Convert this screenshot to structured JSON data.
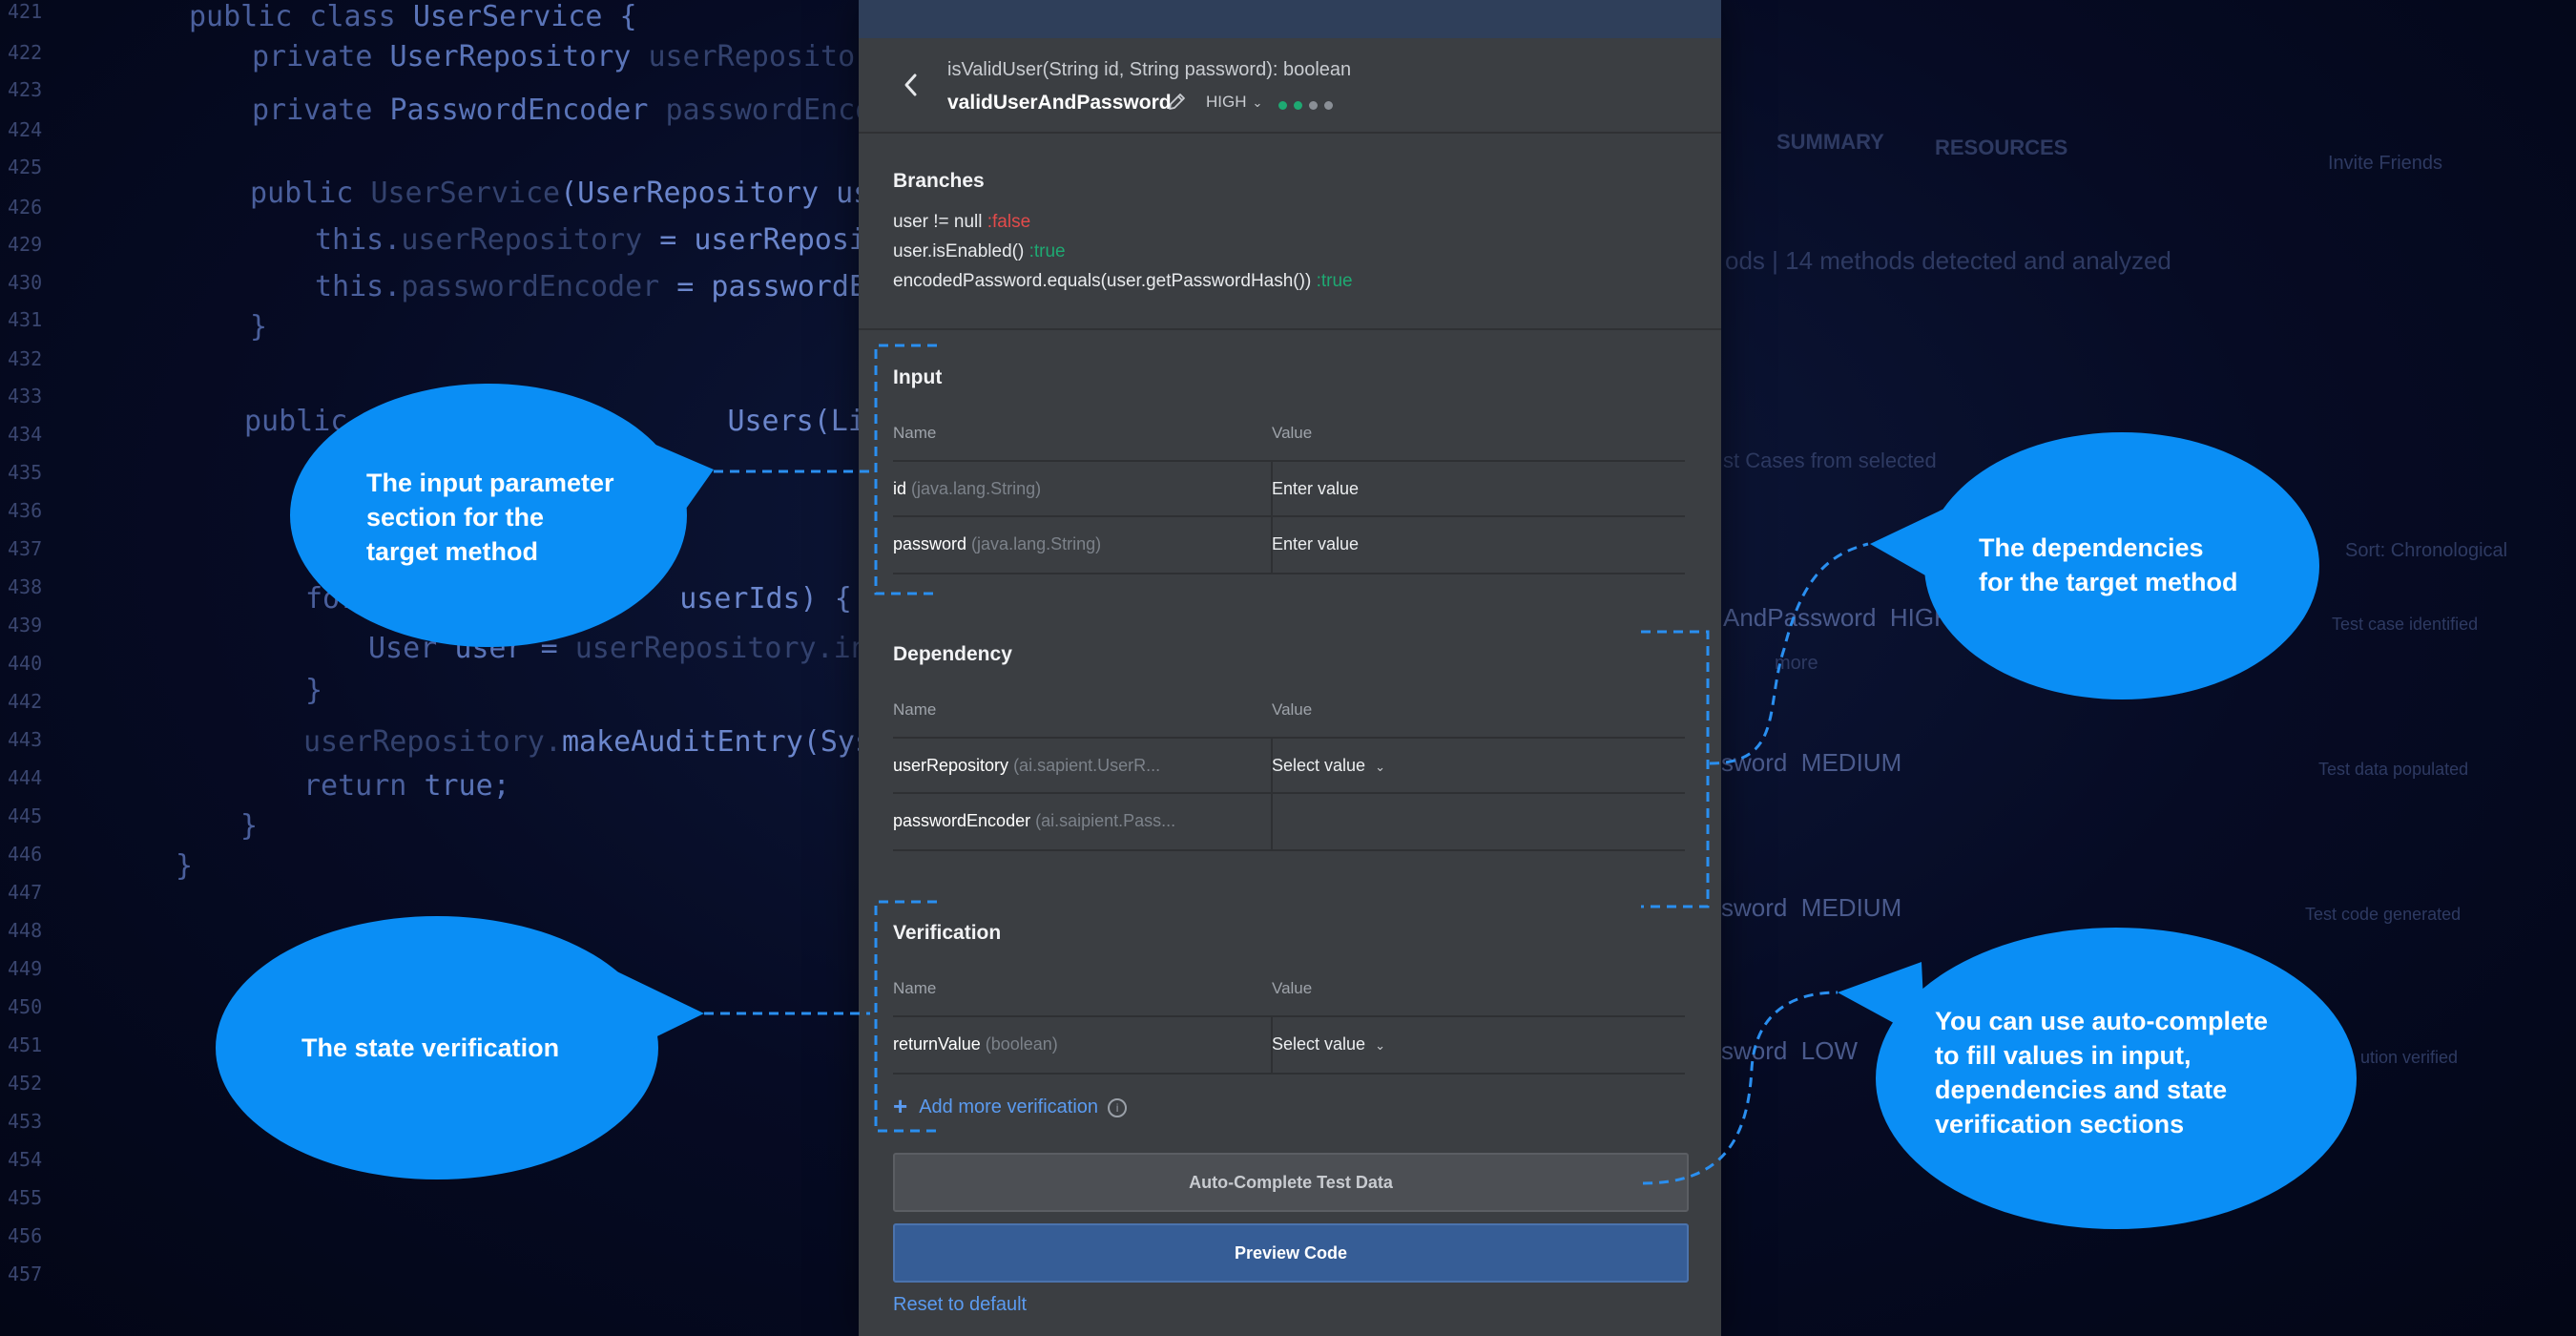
{
  "code_background": {
    "line_numbers": [
      "421",
      "422",
      "423",
      "424",
      "425",
      "426",
      "429",
      "430",
      "431",
      "432",
      "433",
      "434",
      "435",
      "436",
      "437",
      "438",
      "439",
      "440",
      "442",
      "443",
      "444",
      "445",
      "446",
      "447",
      "448",
      "449",
      "450",
      "451",
      "452",
      "453",
      "454",
      "455",
      "456",
      "457"
    ],
    "lines": [
      {
        "kw": "public class ",
        "tp": "UserService {",
        "fd": "",
        "fn": ""
      },
      {
        "kw": "private ",
        "tp": "UserRepository ",
        "fd": "userRepository;",
        "fn": ""
      },
      {
        "kw": "private ",
        "tp": "PasswordEncoder ",
        "fd": "passwordEncoder;",
        "fn": ""
      },
      {
        "kw": "public ",
        "tp": "",
        "fd": "UserService",
        "fn": "(UserRepository userRe"
      },
      {
        "kw": "this.",
        "tp": "",
        "fd": "userRepository",
        "fn": " = userRepositor"
      },
      {
        "kw": "this.",
        "tp": "",
        "fd": "passwordEncoder",
        "fn": " = passwordEnco"
      },
      {
        "kw": "}",
        "tp": "",
        "fd": "",
        "fn": ""
      },
      {
        "kw": "public ",
        "tp": "",
        "fd": "",
        "fn": "Users(List<Str"
      },
      {
        "kw": "for ",
        "tp": "",
        "fd": "",
        "fn": "userIds) {"
      },
      {
        "kw": "User ",
        "tp": "user = ",
        "fd": "userRepository.inva",
        "fn": ""
      },
      {
        "kw": "}",
        "tp": "",
        "fd": "",
        "fn": ""
      },
      {
        "kw": "",
        "tp": "",
        "fd": "userRepository.",
        "fn": "makeAuditEntry(Syste"
      },
      {
        "kw": "return ",
        "tp": "true;",
        "fd": "",
        "fn": ""
      },
      {
        "kw": "}",
        "tp": "",
        "fd": "",
        "fn": ""
      },
      {
        "kw": "}",
        "tp": "",
        "fd": "",
        "fn": ""
      }
    ],
    "right_side": {
      "tabs": [
        "SUMMARY",
        "RESOURCES"
      ],
      "invite": "Invite Friends",
      "methods_summary": "ods | 14 methods detected and analyzed",
      "cases_label": "st Cases from selected",
      "sort_label": "Sort: Chronological",
      "method_rows": [
        "AndPassword  HIGH",
        "sword  MEDIUM",
        "sword  MEDIUM",
        "sword  LOW"
      ],
      "more": "more",
      "steps": [
        "Test case identified",
        "Test data populated",
        "Test code generated",
        "ution verified"
      ]
    }
  },
  "panel": {
    "signature": "isValidUser(String id, String password): boolean",
    "method_name": "validUserAndPassword",
    "priority": "HIGH",
    "priority_dots": [
      "#1ea972",
      "#1ea972",
      "#8a8f96",
      "#8a8f96"
    ],
    "branches": {
      "title": "Branches",
      "lines": [
        {
          "text": "user != null ",
          "result": ":false",
          "status": "false"
        },
        {
          "text": "user.isEnabled() ",
          "result": ":true",
          "status": "true"
        },
        {
          "text": "encodedPassword.equals(user.getPasswordHash()) ",
          "result": ":true",
          "status": "true"
        }
      ]
    },
    "input": {
      "title": "Input",
      "col_name": "Name",
      "col_value": "Value",
      "rows": [
        {
          "name": "id",
          "type": " (java.lang.String)",
          "value": "Enter value"
        },
        {
          "name": "password",
          "type": " (java.lang.String)",
          "value": "Enter value"
        }
      ]
    },
    "dependency": {
      "title": "Dependency",
      "col_name": "Name",
      "col_value": "Value",
      "rows": [
        {
          "name": "userRepository",
          "type": " (ai.sapient.UserR...",
          "value": "Select value"
        },
        {
          "name": "passwordEncoder",
          "type": " (ai.saipient.Pass...",
          "value": ""
        }
      ]
    },
    "verification": {
      "title": "Verification",
      "col_name": "Name",
      "col_value": "Value",
      "rows": [
        {
          "name": "returnValue",
          "type": " (boolean)",
          "value": "Select value"
        }
      ],
      "add_more": "Add more verification"
    },
    "buttons": {
      "auto_complete": "Auto-Complete Test Data",
      "preview": "Preview Code",
      "reset": "Reset to default"
    }
  },
  "annotations": {
    "bubble_color": "#0a8ef5",
    "input": [
      "The input parameter",
      "section for the",
      "target method"
    ],
    "dependencies": [
      "The dependencies",
      "for the target method"
    ],
    "verification": [
      "The state verification"
    ],
    "autocomplete": [
      "You can use auto-complete",
      "to fill values in input,",
      "dependencies and state",
      "verification sections"
    ]
  }
}
